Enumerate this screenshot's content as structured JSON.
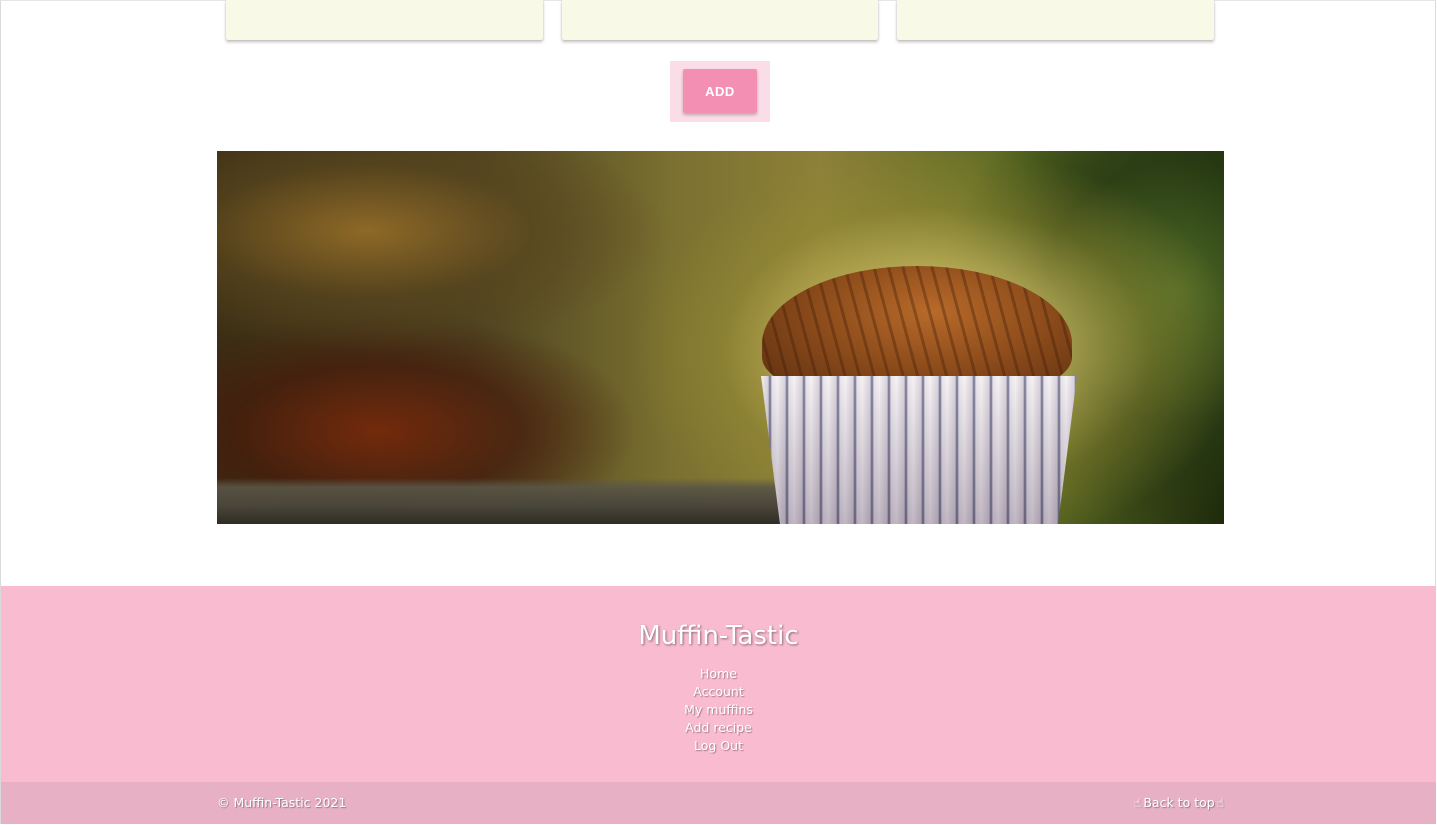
{
  "recipe_cards": [
    {
      "id": "card-1"
    },
    {
      "id": "card-2"
    },
    {
      "id": "card-3"
    }
  ],
  "add_button": {
    "label": "ADD"
  },
  "hero": {
    "image": "muffin-photo",
    "colors": {
      "background_center": "#d8c978",
      "muffin_top": "#8a4a1a",
      "liner": "#e8e4ea"
    }
  },
  "footer": {
    "title": "Muffin-Tastic",
    "links": [
      "Home",
      "Account",
      "My muffins",
      "Add recipe",
      "Log Out"
    ],
    "copyright": "© Muffin-Tastic 2021",
    "back_to_top": "Back to top",
    "back_to_top_icon": "pointing-hand-icon"
  },
  "colors": {
    "card_bg": "#f8f9e6",
    "accent_pink": "#f38fb3",
    "button_halo": "#fbdde8",
    "footer_bg": "#f8bbd0",
    "copyright_bg": "#e8b0c5"
  }
}
